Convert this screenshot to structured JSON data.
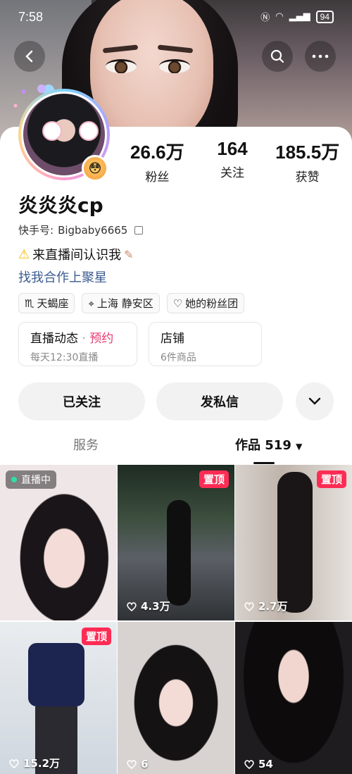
{
  "status_bar": {
    "time": "7:58",
    "battery": "94"
  },
  "profile": {
    "followers": "26.6万",
    "followers_label": "粉丝",
    "following": "164",
    "following_label": "关注",
    "likes": "185.5万",
    "likes_label": "获赞",
    "name": "炎炎炎cp",
    "kuaishou_id_label": "快手号:",
    "kuaishou_id": "Bigbaby6665",
    "bio": "来直播间认识我",
    "cooperation_link": "找我合作上聚星"
  },
  "tags": [
    {
      "icon": "scorpio-icon",
      "label": "天蝎座"
    },
    {
      "icon": "location-icon",
      "label": "上海 静安区"
    },
    {
      "icon": "fan-club-icon",
      "label": "她的粉丝团"
    }
  ],
  "live_box": {
    "title": "直播动态",
    "action": "预约",
    "subtitle": "每天12:30直播"
  },
  "shop_box": {
    "title": "店铺",
    "subtitle": "6件商品"
  },
  "buttons": {
    "followed": "已关注",
    "message": "发私信"
  },
  "tabs": {
    "services": "服务",
    "works": "作品 519"
  },
  "tiles": [
    {
      "badge": "直播中",
      "likes": ""
    },
    {
      "badge": "置顶",
      "likes": "4.3万"
    },
    {
      "badge": "置顶",
      "likes": "2.7万"
    },
    {
      "badge": "置顶",
      "likes": "15.2万"
    },
    {
      "badge": "",
      "likes": "6"
    },
    {
      "badge": "",
      "likes": "54"
    }
  ],
  "colors": {
    "accent_pink": "#fe2c55",
    "link_blue": "#3b5b8f",
    "reserve_pink": "#e73a72"
  }
}
